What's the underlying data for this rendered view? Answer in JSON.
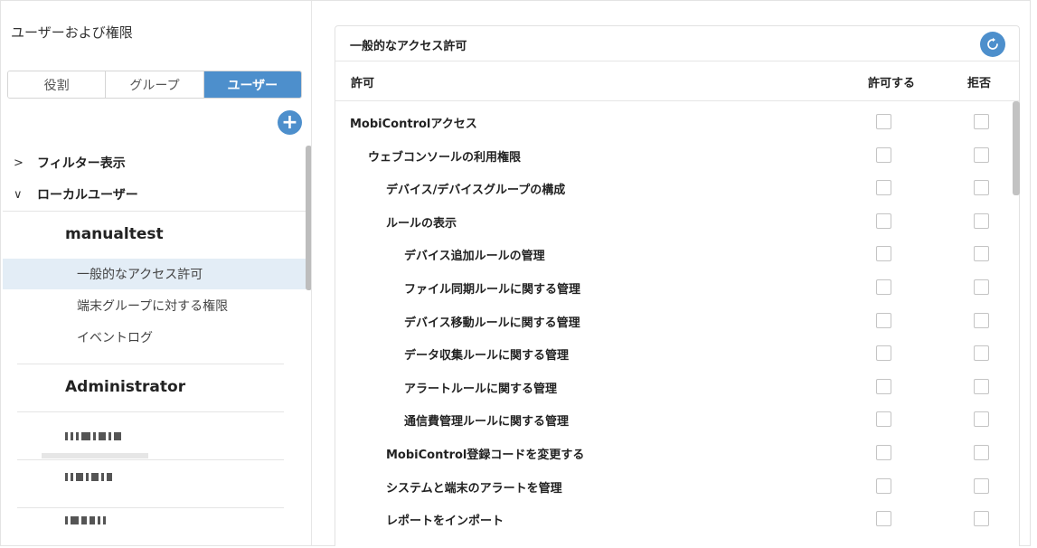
{
  "left_panel": {
    "title": "ユーザーおよび権限",
    "tabs": [
      {
        "label": "役割",
        "active": false
      },
      {
        "label": "グループ",
        "active": false
      },
      {
        "label": "ユーザー",
        "active": true
      }
    ],
    "add_icon": "plus-icon",
    "filter": {
      "chevron": ">",
      "label": "フィルター表示"
    },
    "local_users": {
      "chevron": "∨",
      "label": "ローカルユーザー"
    },
    "users": [
      {
        "name": "manualtest",
        "items": [
          {
            "label": "一般的なアクセス許可",
            "selected": true
          },
          {
            "label": "端末グループに対する権限",
            "selected": false
          },
          {
            "label": "イベントログ",
            "selected": false
          }
        ]
      },
      {
        "name": "Administrator"
      }
    ]
  },
  "main": {
    "card_title": "一般的なアクセス許可",
    "refresh_icon": "refresh-icon",
    "columns": {
      "permission": "許可",
      "allow": "許可する",
      "deny": "拒否"
    },
    "rows": [
      {
        "label": "MobiControlアクセス",
        "level": 0,
        "allow": false,
        "deny": false
      },
      {
        "label": "ウェブコンソールの利用権限",
        "level": 1,
        "allow": false,
        "deny": false
      },
      {
        "label": "デバイス/デバイスグループの構成",
        "level": 2,
        "allow": false,
        "deny": false
      },
      {
        "label": "ルールの表示",
        "level": 2,
        "allow": false,
        "deny": false
      },
      {
        "label": "デバイス追加ルールの管理",
        "level": 3,
        "allow": false,
        "deny": false
      },
      {
        "label": "ファイル同期ルールに関する管理",
        "level": 3,
        "allow": false,
        "deny": false
      },
      {
        "label": "デバイス移動ルールに関する管理",
        "level": 3,
        "allow": false,
        "deny": false
      },
      {
        "label": "データ収集ルールに関する管理",
        "level": 3,
        "allow": false,
        "deny": false
      },
      {
        "label": "アラートルールに関する管理",
        "level": 3,
        "allow": false,
        "deny": false
      },
      {
        "label": "通信費管理ルールに関する管理",
        "level": 3,
        "allow": false,
        "deny": false
      },
      {
        "label": "MobiControl登録コードを変更する",
        "level": 2,
        "allow": false,
        "deny": false
      },
      {
        "label": "システムと端末のアラートを管理",
        "level": 2,
        "allow": false,
        "deny": false
      },
      {
        "label": "レポートをインポート",
        "level": 2,
        "allow": false,
        "deny": false
      }
    ]
  },
  "colors": {
    "accent": "#4d8fcc",
    "selected_row": "#e3edf6"
  }
}
